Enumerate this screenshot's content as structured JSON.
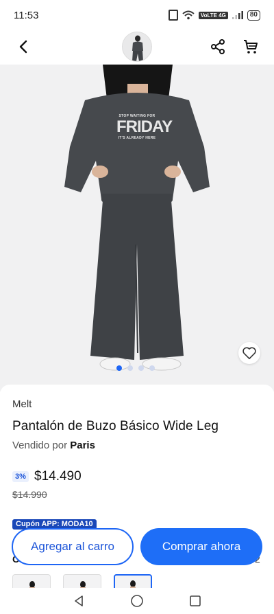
{
  "status": {
    "time": "11:53",
    "network_badge": "VoLTE 4G",
    "battery": "80"
  },
  "nav": {
    "back_icon": "chevron-left-icon",
    "share_icon": "share-icon",
    "cart_icon": "cart-icon"
  },
  "product": {
    "brand": "Melt",
    "title": "Pantalón de Buzo Básico Wide Leg",
    "seller_prefix": "Vendido por ",
    "seller_name": "Paris",
    "discount_badge": "3%",
    "price": "$14.490",
    "old_price": "$14.990",
    "coupon": "Cupón APP: MODA10",
    "hidden_partial_left": "C",
    "hidden_partial_right": "2"
  },
  "shirt_print": {
    "line1": "STOP WAITING FOR",
    "line2": "FRIDAY",
    "line3": "IT'S ALREADY HERE"
  },
  "carousel": {
    "dot_count": 4,
    "active_index": 0
  },
  "actions": {
    "add_to_cart": "Agregar al carro",
    "buy_now": "Comprar ahora"
  },
  "colors": {
    "accent": "#1e6ef7",
    "coupon_bg": "#1a48b8",
    "garment": "#46494d"
  }
}
